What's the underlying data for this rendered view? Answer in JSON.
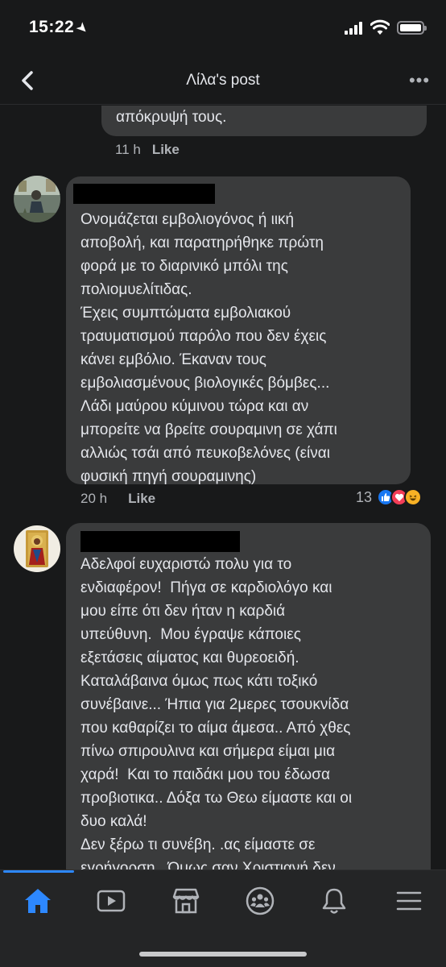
{
  "status_bar": {
    "time": "15:22"
  },
  "header": {
    "title": "Λίλα's post"
  },
  "comments": [
    {
      "text": "απόκρυψή τους.",
      "time": "11 h",
      "like_label": "Like"
    },
    {
      "text": "Ονομάζεται εμβολιογόνος ή ιική\nαποβολή, και παρατηρήθηκε πρώτη\nφορά με το διαρινικό μπόλι της\nπολιομυελίτιδας.\nΈχεις συμπτώματα εμβολιακού\nτραυματισμού παρόλο που δεν έχεις\nκάνει εμβόλιο. Έκαναν τους\nεμβολιασμένους βιολογικές βόμβες...\nΛάδι μαύρου κύμινου τώρα και αν\nμπορείτε να βρείτε σουραμινη σε χάπι\nαλλιώς τσάι από πευκοβελόνες (είναι\nφυσική πηγή σουραμινης)",
      "time": "20 h",
      "like_label": "Like",
      "reaction_count": "13",
      "reactions": [
        "like-reaction",
        "love-reaction",
        "haha-reaction"
      ]
    },
    {
      "text": "Αδελφοί ευχαριστώ πολυ για το\nενδιαφέρον!  Πήγα σε καρδιολόγο και\nμου είπε ότι δεν ήταν η καρδιά\nυπεύθυνη.  Μου έγραψε κάποιες\nεξετάσεις αίματος και θυρεοειδή.\nΚαταλάβαινα όμως πως κάτι τοξικό\nσυνέβαινε... Ήπια για 2μερες τσουκνίδα\nπου καθαρίζει το αίμα άμεσα.. Από χθες\nπίνω σπιρουλινα και σήμερα είμαι μια\nχαρά!  Και το παιδάκι μου του έδωσα\nπροβιοτικα.. Δόξα τω Θεω είμαστε και οι\nδυο καλά!\nΔεν ξέρω τι συνέβη. .ας είμαστε σε\nεγρήγορση.. Όμως σαν Χριστιανή δεν"
    }
  ],
  "tabs": [
    {
      "icon": "home-icon"
    },
    {
      "icon": "video-icon"
    },
    {
      "icon": "marketplace-icon"
    },
    {
      "icon": "groups-icon"
    },
    {
      "icon": "notifications-bell-icon"
    },
    {
      "icon": "menu-icon"
    }
  ],
  "colors": {
    "accent": "#2d88ff",
    "bubble": "#3a3b3c",
    "background": "#18191a",
    "like": "#1877f2",
    "love": "#f33e58",
    "haha": "#f7b125"
  }
}
